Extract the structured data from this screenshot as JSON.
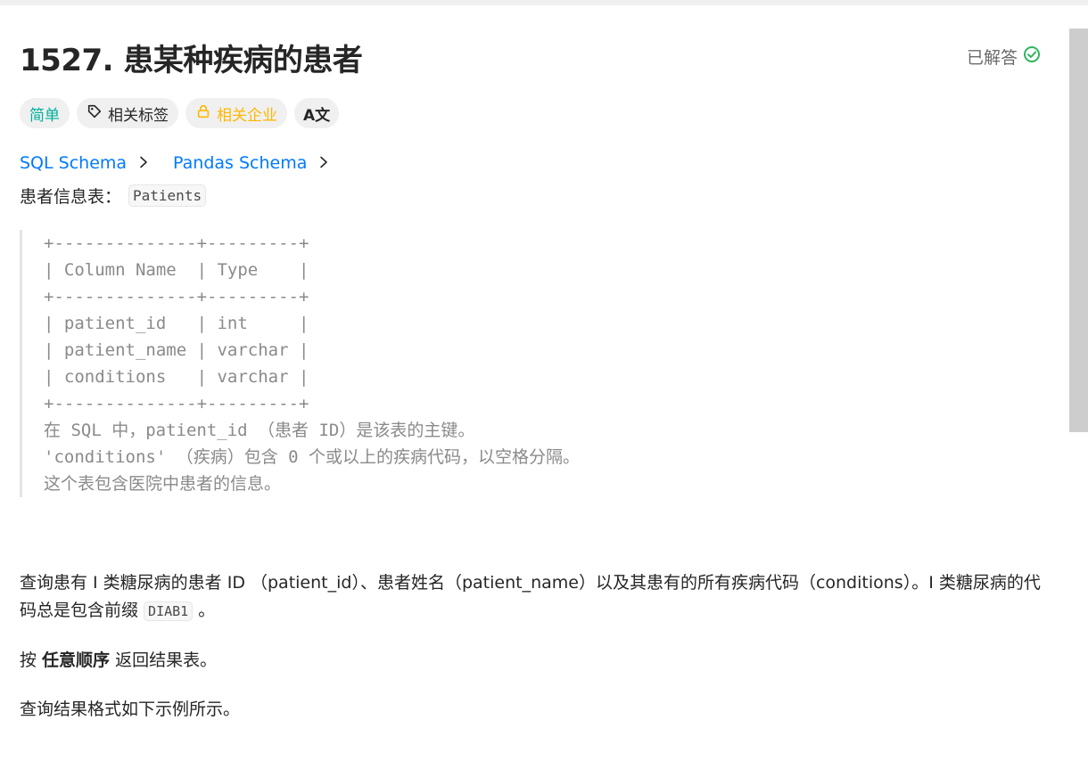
{
  "problem": {
    "title": "1527. 患某种疾病的患者",
    "status": "已解答"
  },
  "tags": {
    "difficulty": "简单",
    "topics": "相关标签",
    "companies": "相关企业",
    "language_icon_text": "A文"
  },
  "schemas": [
    {
      "label": "SQL Schema"
    },
    {
      "label": "Pandas Schema"
    }
  ],
  "table_info": {
    "label": "患者信息表：",
    "name": "Patients"
  },
  "schema_block": "+--------------+---------+\n| Column Name  | Type    |\n+--------------+---------+\n| patient_id   | int     |\n| patient_name | varchar |\n| conditions   | varchar |\n+--------------+---------+\n在 SQL 中，patient_id （患者 ID）是该表的主键。\n'conditions' （疾病）包含 0 个或以上的疾病代码，以空格分隔。\n这个表包含医院中患者的信息。",
  "description": {
    "p1_a": "查询患有 I 类糖尿病的患者 ID （patient_id）、患者姓名（patient_name）以及其患有的所有疾病代码（conditions）。I 类糖尿病的代码总是包含前缀 ",
    "p1_code": "DIAB1",
    "p1_b": " 。",
    "p2_a": "按 ",
    "p2_bold": "任意顺序",
    "p2_b": " 返回结果表。",
    "p3": "查询结果格式如下示例所示。"
  },
  "colors": {
    "easy": "#00af9b",
    "company": "#ffb700",
    "link": "#007aff",
    "solved_check": "#2db55d"
  }
}
